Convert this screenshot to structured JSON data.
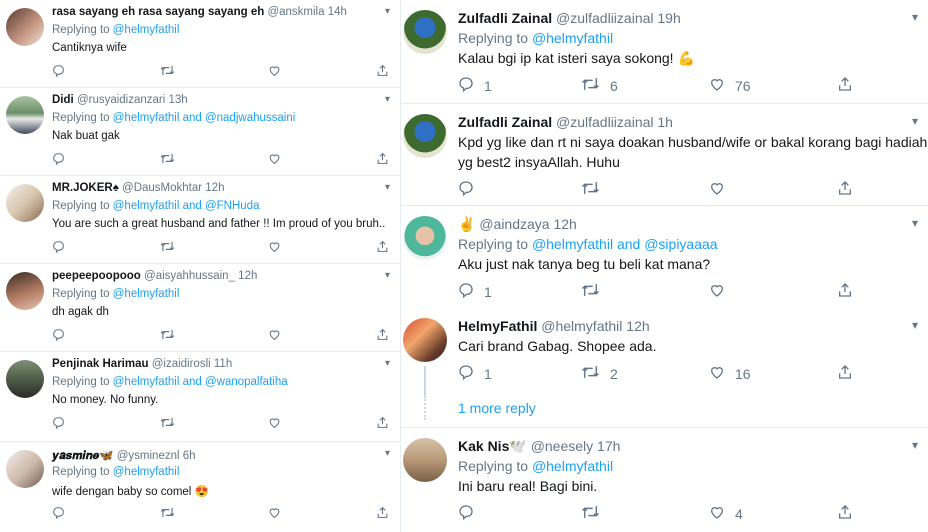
{
  "left_tweets": [
    {
      "name": "rasa sayang eh rasa sayang sayang eh",
      "handle": "@anskmila",
      "time": "14h",
      "replying_prefix": "Replying to",
      "mentions": "@helmyfathil",
      "text": "Cantiknya wife",
      "replies": "",
      "retweets": "",
      "likes": ""
    },
    {
      "name": "Didi",
      "handle": "@rusyaidizanzari",
      "time": "13h",
      "replying_prefix": "Replying to",
      "mentions": "@helmyfathil and @nadjwahussaini",
      "text": "Nak buat gak",
      "replies": "",
      "retweets": "",
      "likes": ""
    },
    {
      "name": "MR.JOKER♠",
      "handle": "@DausMokhtar",
      "time": "12h",
      "replying_prefix": "Replying to",
      "mentions": "@helmyfathil and @FNHuda",
      "text": "You are such a great husband and father !! Im proud of you bruh..",
      "replies": "",
      "retweets": "",
      "likes": ""
    },
    {
      "name": "peepeepoopooo",
      "handle": "@aisyahhussain_",
      "time": "12h",
      "replying_prefix": "Replying to",
      "mentions": "@helmyfathil",
      "text": "dh agak dh",
      "replies": "",
      "retweets": "",
      "likes": ""
    },
    {
      "name": "Penjinak Harimau",
      "handle": "@izaidirosli",
      "time": "11h",
      "replying_prefix": "Replying to",
      "mentions": "@helmyfathil and @wanopalfatiha",
      "text": "No money. No funny.",
      "replies": "",
      "retweets": "",
      "likes": ""
    },
    {
      "name": "𝒚𝒂𝒔𝒎𝒊𝒏𝒆🦋",
      "handle": "@ysmineznl",
      "time": "6h",
      "replying_prefix": "Replying to",
      "mentions": "@helmyfathil",
      "text": "wife dengan baby so comel 😍",
      "replies": "",
      "retweets": "",
      "likes": ""
    }
  ],
  "right_tweets": [
    {
      "name": "Zulfadli Zainal",
      "handle": "@zulfadliizainal",
      "time": "19h",
      "replying_prefix": "Replying to",
      "mentions": "@helmyfathil",
      "text": "Kalau bgi ip kat isteri saya sokong! 💪",
      "replies": "1",
      "retweets": "6",
      "likes": "76"
    },
    {
      "name": "Zulfadli Zainal",
      "handle": "@zulfadliizainal",
      "time": "1h",
      "replying_prefix": "",
      "mentions": "",
      "text": "Kpd yg like dan rt ni saya doakan husband/wife or bakal korang bagi hadiah",
      "text2": "yg best2 insyaAllah. Huhu",
      "replies": "",
      "retweets": "",
      "likes": ""
    },
    {
      "name": "✌️",
      "handle": "@aindzaya",
      "time": "12h",
      "replying_prefix": "Replying to",
      "mentions": "@helmyfathil and @sipiyaaaa",
      "text": "Aku just nak tanya beg tu beli kat mana?",
      "replies": "1",
      "retweets": "",
      "likes": ""
    },
    {
      "name": "HelmyFathil",
      "handle": "@helmyfathil",
      "time": "12h",
      "replying_prefix": "",
      "mentions": "",
      "text": "Cari brand Gabag. Shopee ada.",
      "replies": "1",
      "retweets": "2",
      "likes": "16"
    },
    {
      "name": "Kak Nis🕊️",
      "handle": "@neesely",
      "time": "17h",
      "replying_prefix": "Replying to",
      "mentions": "@helmyfathil",
      "text": "Ini baru real! Bagi bini.",
      "replies": "",
      "retweets": "",
      "likes": "4"
    }
  ],
  "more_reply": "1 more reply",
  "icons": {
    "reply": "reply-icon",
    "retweet": "retweet-icon",
    "like": "like-icon",
    "share": "share-icon",
    "caret": "chevron-down-icon"
  },
  "colors": {
    "link": "#1da1f2",
    "secondary": "#657786",
    "border": "#e6ecf0"
  }
}
